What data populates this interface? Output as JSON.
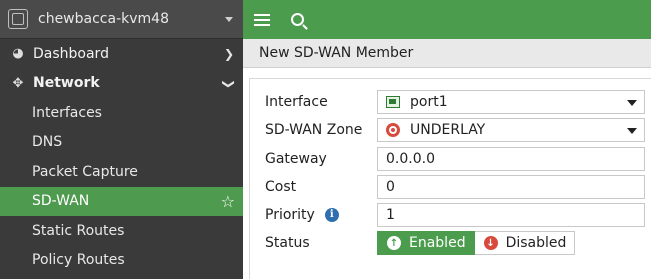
{
  "header": {
    "hostname": "chewbacca-kvm48"
  },
  "sidebar": {
    "items": [
      {
        "label": "Dashboard",
        "icon": "dashboard-icon"
      },
      {
        "label": "Network",
        "icon": "network-icon"
      },
      {
        "label": "Interfaces"
      },
      {
        "label": "DNS"
      },
      {
        "label": "Packet Capture"
      },
      {
        "label": "SD-WAN"
      },
      {
        "label": "Static Routes"
      },
      {
        "label": "Policy Routes"
      }
    ]
  },
  "page": {
    "title": "New SD-WAN Member"
  },
  "form": {
    "interface": {
      "label": "Interface",
      "value": "port1"
    },
    "zone": {
      "label": "SD-WAN Zone",
      "value": "UNDERLAY"
    },
    "gateway": {
      "label": "Gateway",
      "value": "0.0.0.0"
    },
    "cost": {
      "label": "Cost",
      "value": "0"
    },
    "priority": {
      "label": "Priority",
      "value": "1"
    },
    "status": {
      "label": "Status",
      "enabled": "Enabled",
      "disabled": "Disabled",
      "selected": "Enabled"
    }
  },
  "colors": {
    "accent": "#4b9c4c",
    "sidebar": "#3a3a3a",
    "danger": "#d94a3c"
  }
}
